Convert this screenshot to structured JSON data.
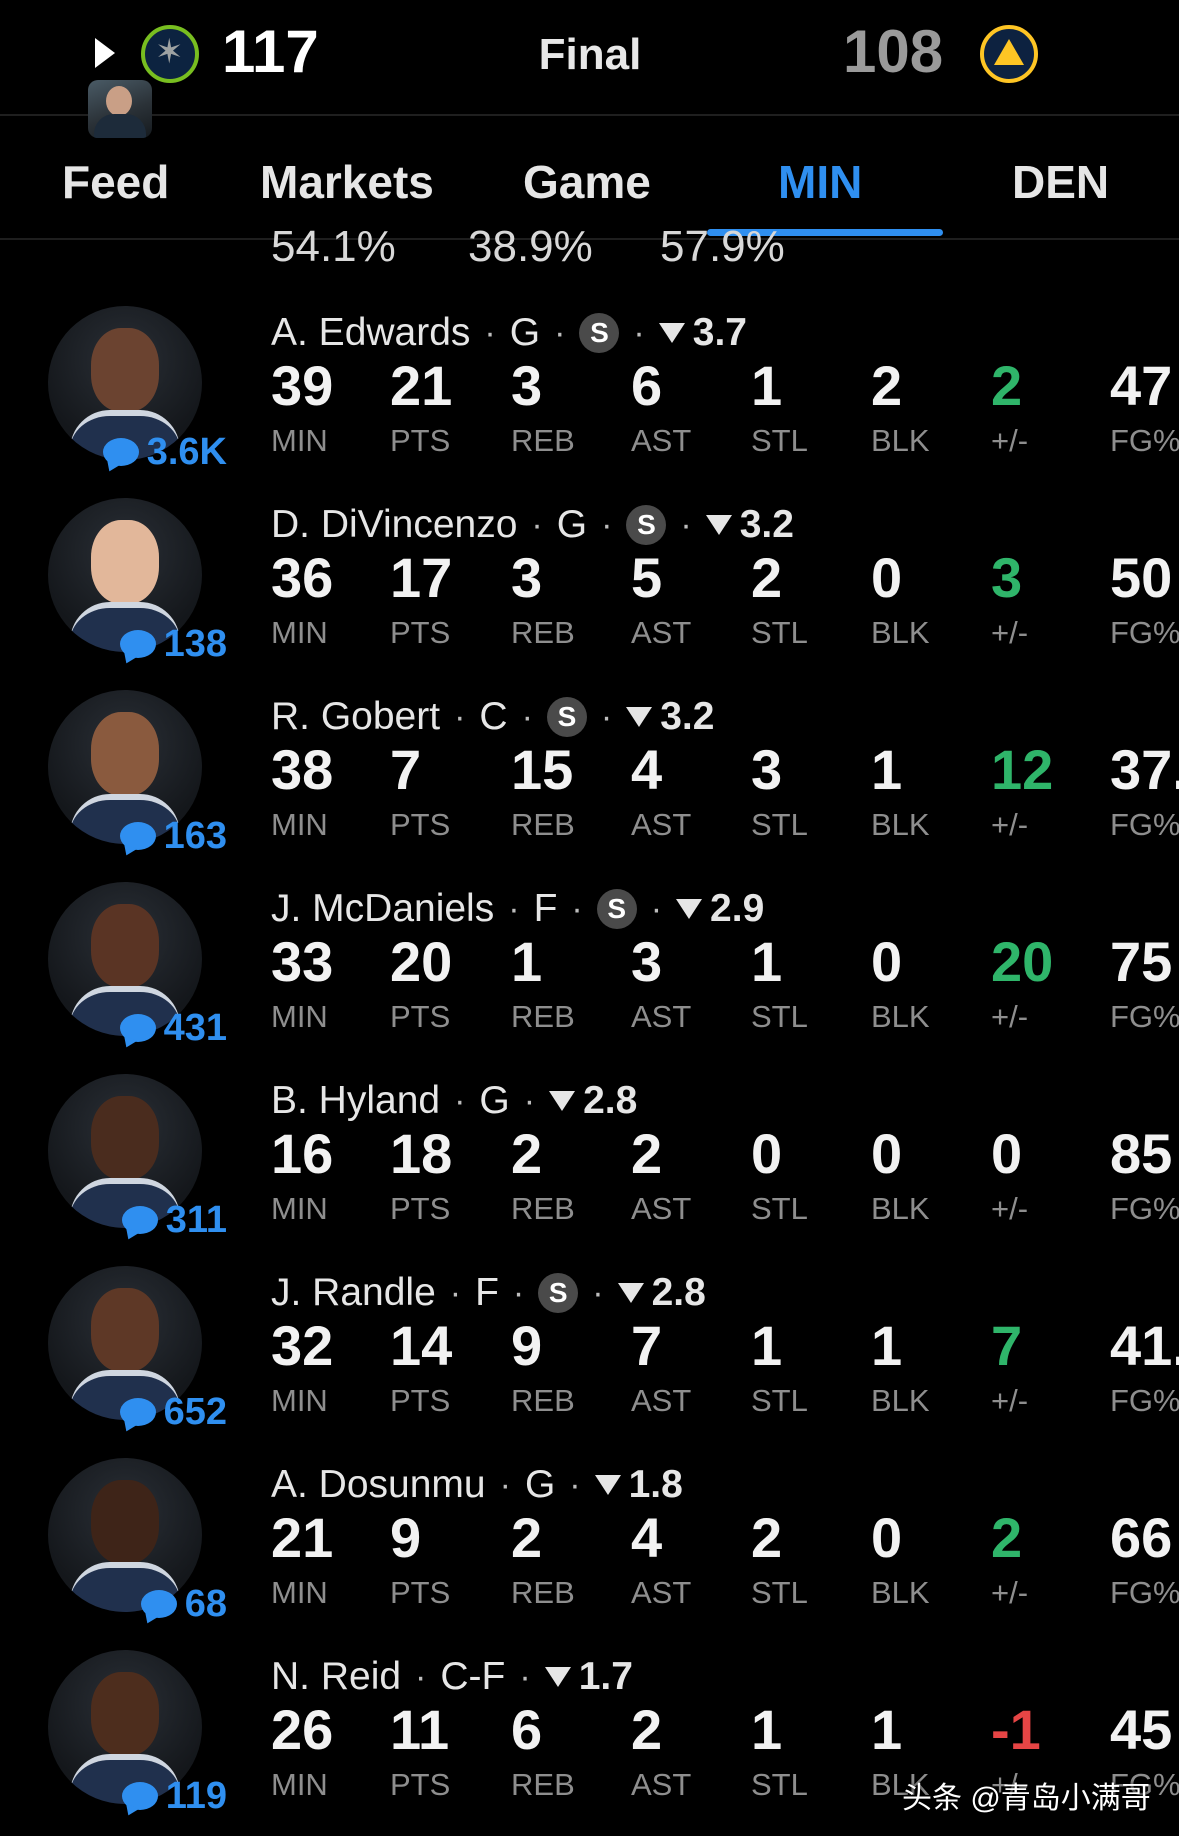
{
  "header": {
    "home_score": "117",
    "status": "Final",
    "away_score": "108"
  },
  "tabs": [
    "Feed",
    "Markets",
    "Game",
    "MIN",
    "DEN"
  ],
  "active_tab": "MIN",
  "partial_row": [
    "54.1%",
    "38.9%",
    "57.9%"
  ],
  "stat_labels": [
    "MIN",
    "PTS",
    "REB",
    "AST",
    "STL",
    "BLK",
    "+/-",
    "FG%"
  ],
  "players": [
    {
      "name": "A. Edwards",
      "pos": "G",
      "starter": true,
      "rating": "3.7",
      "comments": "3.6K",
      "stats": [
        "39",
        "21",
        "3",
        "6",
        "1",
        "2",
        "2",
        "47"
      ],
      "pm_sign": "pos"
    },
    {
      "name": "D. DiVincenzo",
      "pos": "G",
      "starter": true,
      "rating": "3.2",
      "comments": "138",
      "stats": [
        "36",
        "17",
        "3",
        "5",
        "2",
        "0",
        "3",
        "50"
      ],
      "pm_sign": "pos"
    },
    {
      "name": "R. Gobert",
      "pos": "C",
      "starter": true,
      "rating": "3.2",
      "comments": "163",
      "stats": [
        "38",
        "7",
        "15",
        "4",
        "3",
        "1",
        "12",
        "37."
      ],
      "pm_sign": "pos"
    },
    {
      "name": "J. McDaniels",
      "pos": "F",
      "starter": true,
      "rating": "2.9",
      "comments": "431",
      "stats": [
        "33",
        "20",
        "1",
        "3",
        "1",
        "0",
        "20",
        "75"
      ],
      "pm_sign": "pos"
    },
    {
      "name": "B. Hyland",
      "pos": "G",
      "starter": false,
      "rating": "2.8",
      "comments": "311",
      "stats": [
        "16",
        "18",
        "2",
        "2",
        "0",
        "0",
        "0",
        "85"
      ],
      "pm_sign": "zero"
    },
    {
      "name": "J. Randle",
      "pos": "F",
      "starter": true,
      "rating": "2.8",
      "comments": "652",
      "stats": [
        "32",
        "14",
        "9",
        "7",
        "1",
        "1",
        "7",
        "41."
      ],
      "pm_sign": "pos"
    },
    {
      "name": "A. Dosunmu",
      "pos": "G",
      "starter": false,
      "rating": "1.8",
      "comments": "68",
      "stats": [
        "21",
        "9",
        "2",
        "4",
        "2",
        "0",
        "2",
        "66"
      ],
      "pm_sign": "pos"
    },
    {
      "name": "N. Reid",
      "pos": "C-F",
      "starter": false,
      "rating": "1.7",
      "comments": "119",
      "stats": [
        "26",
        "11",
        "6",
        "2",
        "1",
        "1",
        "-1",
        "45"
      ],
      "pm_sign": "neg"
    }
  ],
  "starter_badge": "S",
  "separator": "·",
  "watermark": "头条 @青岛小满哥",
  "colors": {
    "accent": "#2f8ff0",
    "positive": "#2fb56a",
    "negative": "#e64545"
  }
}
